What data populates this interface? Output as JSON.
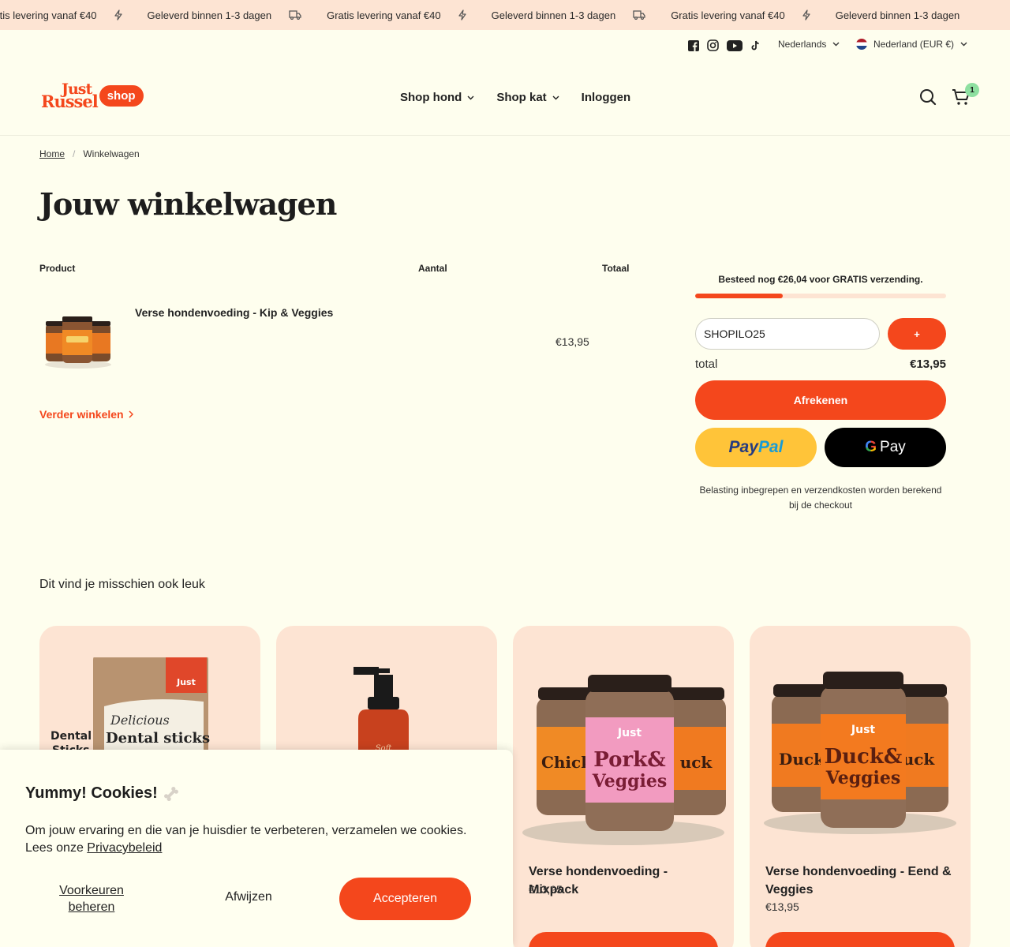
{
  "announcement": {
    "items": [
      {
        "icon": "truck-icon",
        "text": "Gratis levering vanaf €40"
      },
      {
        "icon": "lightning-icon",
        "text": "Geleverd binnen 1-3 dagen"
      },
      {
        "icon": "truck-icon",
        "text": "Gratis levering vanaf €40"
      },
      {
        "icon": "lightning-icon",
        "text": "Geleverd binnen 1-3 dagen"
      },
      {
        "icon": "truck-icon",
        "text": "Gratis levering vanaf €40"
      },
      {
        "icon": "lightning-icon",
        "text": "Geleverd binnen 1-3 dagen"
      }
    ]
  },
  "topbar": {
    "social": [
      "facebook-icon",
      "instagram-icon",
      "youtube-icon",
      "tiktok-icon"
    ],
    "language": "Nederlands",
    "region": "Nederland (EUR €)"
  },
  "header": {
    "logo_line1": "Just",
    "logo_line2": "Russel",
    "logo_pill": "shop",
    "nav": [
      {
        "label": "Shop hond",
        "has_dropdown": true
      },
      {
        "label": "Shop kat",
        "has_dropdown": true
      },
      {
        "label": "Inloggen",
        "has_dropdown": false
      }
    ],
    "cart_count": "1"
  },
  "breadcrumb": {
    "home": "Home",
    "current": "Winkelwagen"
  },
  "page_title": "Jouw winkelwagen",
  "cart": {
    "columns": {
      "product": "Product",
      "quantity": "Aantal",
      "total": "Totaal"
    },
    "items": [
      {
        "name": "Verse hondenvoeding - Kip & Veggies",
        "total": "€13,95"
      }
    ],
    "continue_label": "Verder winkelen"
  },
  "summary": {
    "shipping_message": "Besteed nog €26,04 voor GRATIS verzending.",
    "shipping_progress": 0.35,
    "coupon_value": "SHOPILO25",
    "coupon_button": "+",
    "total_label": "total",
    "total_value": "€13,95",
    "checkout_label": "Afrekenen",
    "paypal_label_1": "Pay",
    "paypal_label_2": "Pal",
    "gpay_g": "G",
    "gpay_label": "Pay",
    "tax_note": "Belasting inbegrepen en verzendkosten worden berekend bij de checkout"
  },
  "recommendations": {
    "title": "Dit vind je misschien ook leuk",
    "products": [
      {
        "name": "",
        "price": ""
      },
      {
        "name": "",
        "price": ""
      },
      {
        "name": "Verse hondenvoeding - Mixpack",
        "price": "€13,95"
      },
      {
        "name": "Verse hondenvoeding - Eend & Veggies",
        "price": "€13,95"
      }
    ]
  },
  "cookie": {
    "title": "Yummy! Cookies!",
    "text": "Om jouw ervaring en die van je huisdier te verbeteren, verzamelen we cookies. Lees onze ",
    "link": "Privacybeleid",
    "preferences": "Voorkeuren beheren",
    "reject": "Afwijzen",
    "accept": "Accepteren"
  },
  "colors": {
    "accent": "#f4471c",
    "background": "#fefeee",
    "peach": "#fde4d3",
    "badge": "#8ee0a0"
  }
}
